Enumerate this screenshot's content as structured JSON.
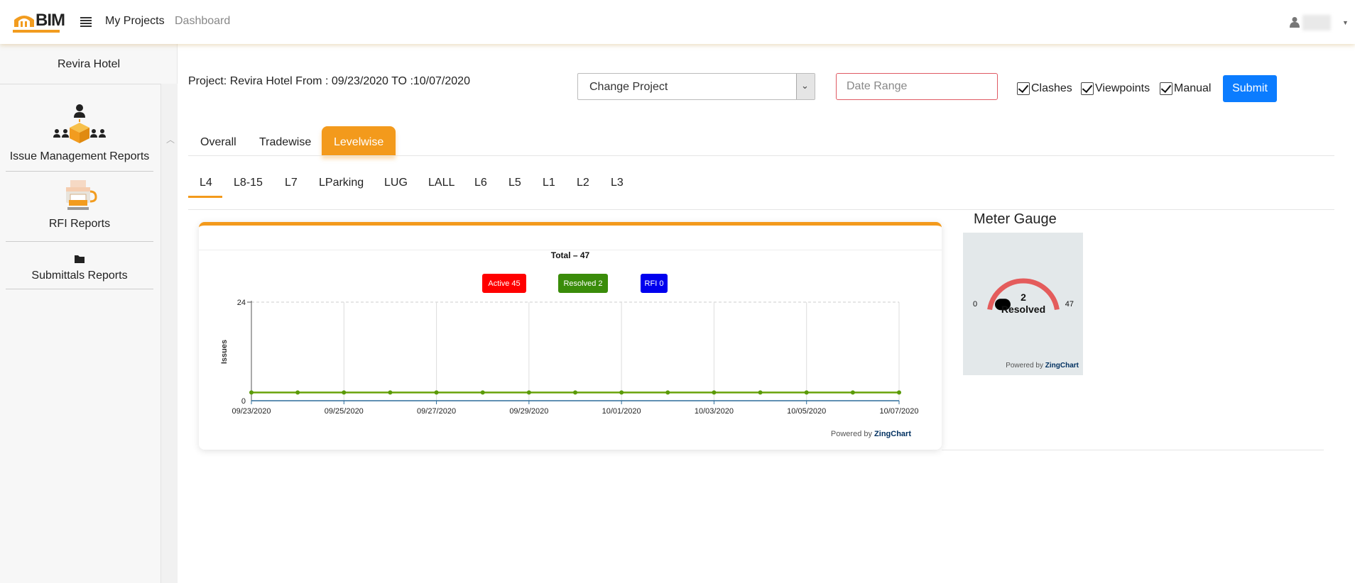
{
  "header": {
    "logo_text": "BIM",
    "nav": [
      "My Projects",
      "Dashboard"
    ]
  },
  "sidebar": {
    "title": "Revira Hotel",
    "items": [
      {
        "label": "Issue Management Reports",
        "icon": "issue-management-icon"
      },
      {
        "label": "RFI Reports",
        "icon": "rfi-printer-icon"
      },
      {
        "label": "Submittals Reports",
        "icon": "folder-icon"
      }
    ]
  },
  "toolbar": {
    "project_text": "Project: Revira Hotel From : 09/23/2020 TO :10/07/2020",
    "project_select": "Change Project",
    "date_placeholder": "Date Range",
    "checkboxes": [
      {
        "label": "Clashes",
        "checked": true
      },
      {
        "label": "Viewpoints",
        "checked": true
      },
      {
        "label": "Manual",
        "checked": true
      }
    ],
    "submit_label": "Submit"
  },
  "tabs": [
    "Overall",
    "Tradewise",
    "Levelwise"
  ],
  "active_tab": "Levelwise",
  "levels": [
    "L4",
    "L8-15",
    "L7",
    "LParking",
    "LUG",
    "LALL",
    "L6",
    "L5",
    "L1",
    "L2",
    "L3"
  ],
  "active_level": "L4",
  "chart_data": {
    "type": "line",
    "title": "Total – 47",
    "legend": [
      {
        "label": "Active 45",
        "color": "#ff0000"
      },
      {
        "label": "Resolved 2",
        "color": "#3a8c0a"
      },
      {
        "label": "RFI 0",
        "color": "#0000ee"
      }
    ],
    "ylabel": "Issues",
    "ylim": [
      0,
      24
    ],
    "x": [
      "09/23/2020",
      "09/24/2020",
      "09/25/2020",
      "09/26/2020",
      "09/27/2020",
      "09/28/2020",
      "09/29/2020",
      "09/30/2020",
      "10/01/2020",
      "10/02/2020",
      "10/03/2020",
      "10/04/2020",
      "10/05/2020",
      "10/06/2020",
      "10/07/2020"
    ],
    "x_tick_labels": [
      "09/23/2020",
      "09/25/2020",
      "09/27/2020",
      "09/29/2020",
      "10/01/2020",
      "10/03/2020",
      "10/05/2020",
      "10/07/2020"
    ],
    "series": [
      {
        "values": [
          2,
          2,
          2,
          2,
          2,
          2,
          2,
          2,
          2,
          2,
          2,
          2,
          2,
          2,
          2
        ],
        "color": "#6aa30a"
      }
    ],
    "powered_by": "Powered by",
    "powered_brand": "ZingChart"
  },
  "gauge": {
    "title": "Meter Gauge",
    "value": 2,
    "min": 0,
    "max": 47,
    "label": "Resolved",
    "arc_color": "#e45c5c",
    "powered_by": "Powered by",
    "powered_brand": "ZingChart"
  }
}
